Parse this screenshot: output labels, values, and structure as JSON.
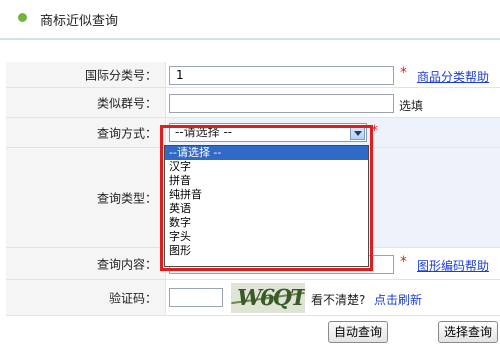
{
  "header": {
    "title": "商标近似查询"
  },
  "form": {
    "class_no": {
      "label": "国际分类号：",
      "value": "1",
      "help_link": "商品分类帮助"
    },
    "group_no": {
      "label": "类似群号：",
      "value": "",
      "note": "选填"
    },
    "query_method": {
      "label": "查询方式：",
      "selected": "--请选择 --",
      "options": [
        "--请选择 --",
        "汉字",
        "拼音",
        "纯拼音",
        "英语",
        "数字",
        "字头",
        "图形"
      ]
    },
    "query_type": {
      "label": "查询类型："
    },
    "query_content": {
      "label": "查询内容：",
      "value": "",
      "help_link": "图形编码帮助"
    },
    "captcha": {
      "label": "验证码：",
      "value": "",
      "image_text": "W6QT",
      "hint": "看不清楚?",
      "refresh": "点击刷新"
    }
  },
  "buttons": {
    "auto_query": "自动查询",
    "select_query": "选择查询"
  },
  "colors": {
    "required_star": "#e02020",
    "link": "#1a3fd6",
    "highlight_box": "#e01e1e",
    "selected_option": "#3169c6"
  }
}
